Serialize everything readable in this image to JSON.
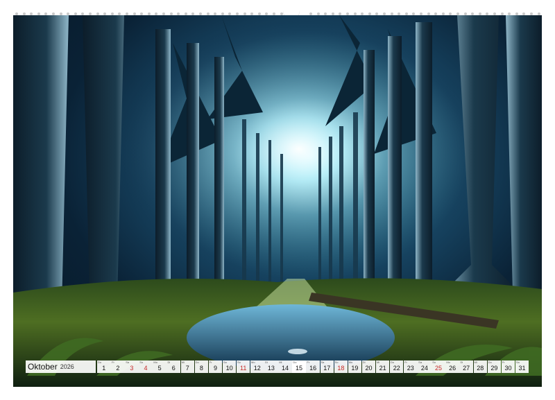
{
  "calendar": {
    "month": "Oktober",
    "year": "2026",
    "days": [
      {
        "n": "1",
        "wd": "Do",
        "red": false
      },
      {
        "n": "2",
        "wd": "Fr",
        "red": false
      },
      {
        "n": "3",
        "wd": "Sa",
        "red": true
      },
      {
        "n": "4",
        "wd": "So",
        "red": true
      },
      {
        "n": "5",
        "wd": "Mo",
        "red": false
      },
      {
        "n": "6",
        "wd": "Di",
        "red": false
      },
      {
        "n": "7",
        "wd": "Mi",
        "red": false
      },
      {
        "n": "8",
        "wd": "Do",
        "red": false
      },
      {
        "n": "9",
        "wd": "Fr",
        "red": false
      },
      {
        "n": "10",
        "wd": "Sa",
        "red": false
      },
      {
        "n": "11",
        "wd": "So",
        "red": true
      },
      {
        "n": "12",
        "wd": "Mo",
        "red": false
      },
      {
        "n": "13",
        "wd": "Di",
        "red": false
      },
      {
        "n": "14",
        "wd": "Mi",
        "red": false
      },
      {
        "n": "15",
        "wd": "Do",
        "red": false
      },
      {
        "n": "16",
        "wd": "Fr",
        "red": false
      },
      {
        "n": "17",
        "wd": "Sa",
        "red": false
      },
      {
        "n": "18",
        "wd": "So",
        "red": true
      },
      {
        "n": "19",
        "wd": "Mo",
        "red": false
      },
      {
        "n": "20",
        "wd": "Di",
        "red": false
      },
      {
        "n": "21",
        "wd": "Mi",
        "red": false
      },
      {
        "n": "22",
        "wd": "Do",
        "red": false
      },
      {
        "n": "23",
        "wd": "Fr",
        "red": false
      },
      {
        "n": "24",
        "wd": "Sa",
        "red": false
      },
      {
        "n": "25",
        "wd": "So",
        "red": true
      },
      {
        "n": "26",
        "wd": "Mo",
        "red": false
      },
      {
        "n": "27",
        "wd": "Di",
        "red": false
      },
      {
        "n": "28",
        "wd": "Mi",
        "red": false
      },
      {
        "n": "29",
        "wd": "Do",
        "red": false
      },
      {
        "n": "30",
        "wd": "Fr",
        "red": false
      },
      {
        "n": "31",
        "wd": "Sa",
        "red": false
      }
    ]
  },
  "colors": {
    "weekend": "#c62828",
    "sky_glow": "#eaffff",
    "forest_dark": "#061522",
    "moss": "#9fbf3a",
    "water": "#2f6f9a"
  }
}
